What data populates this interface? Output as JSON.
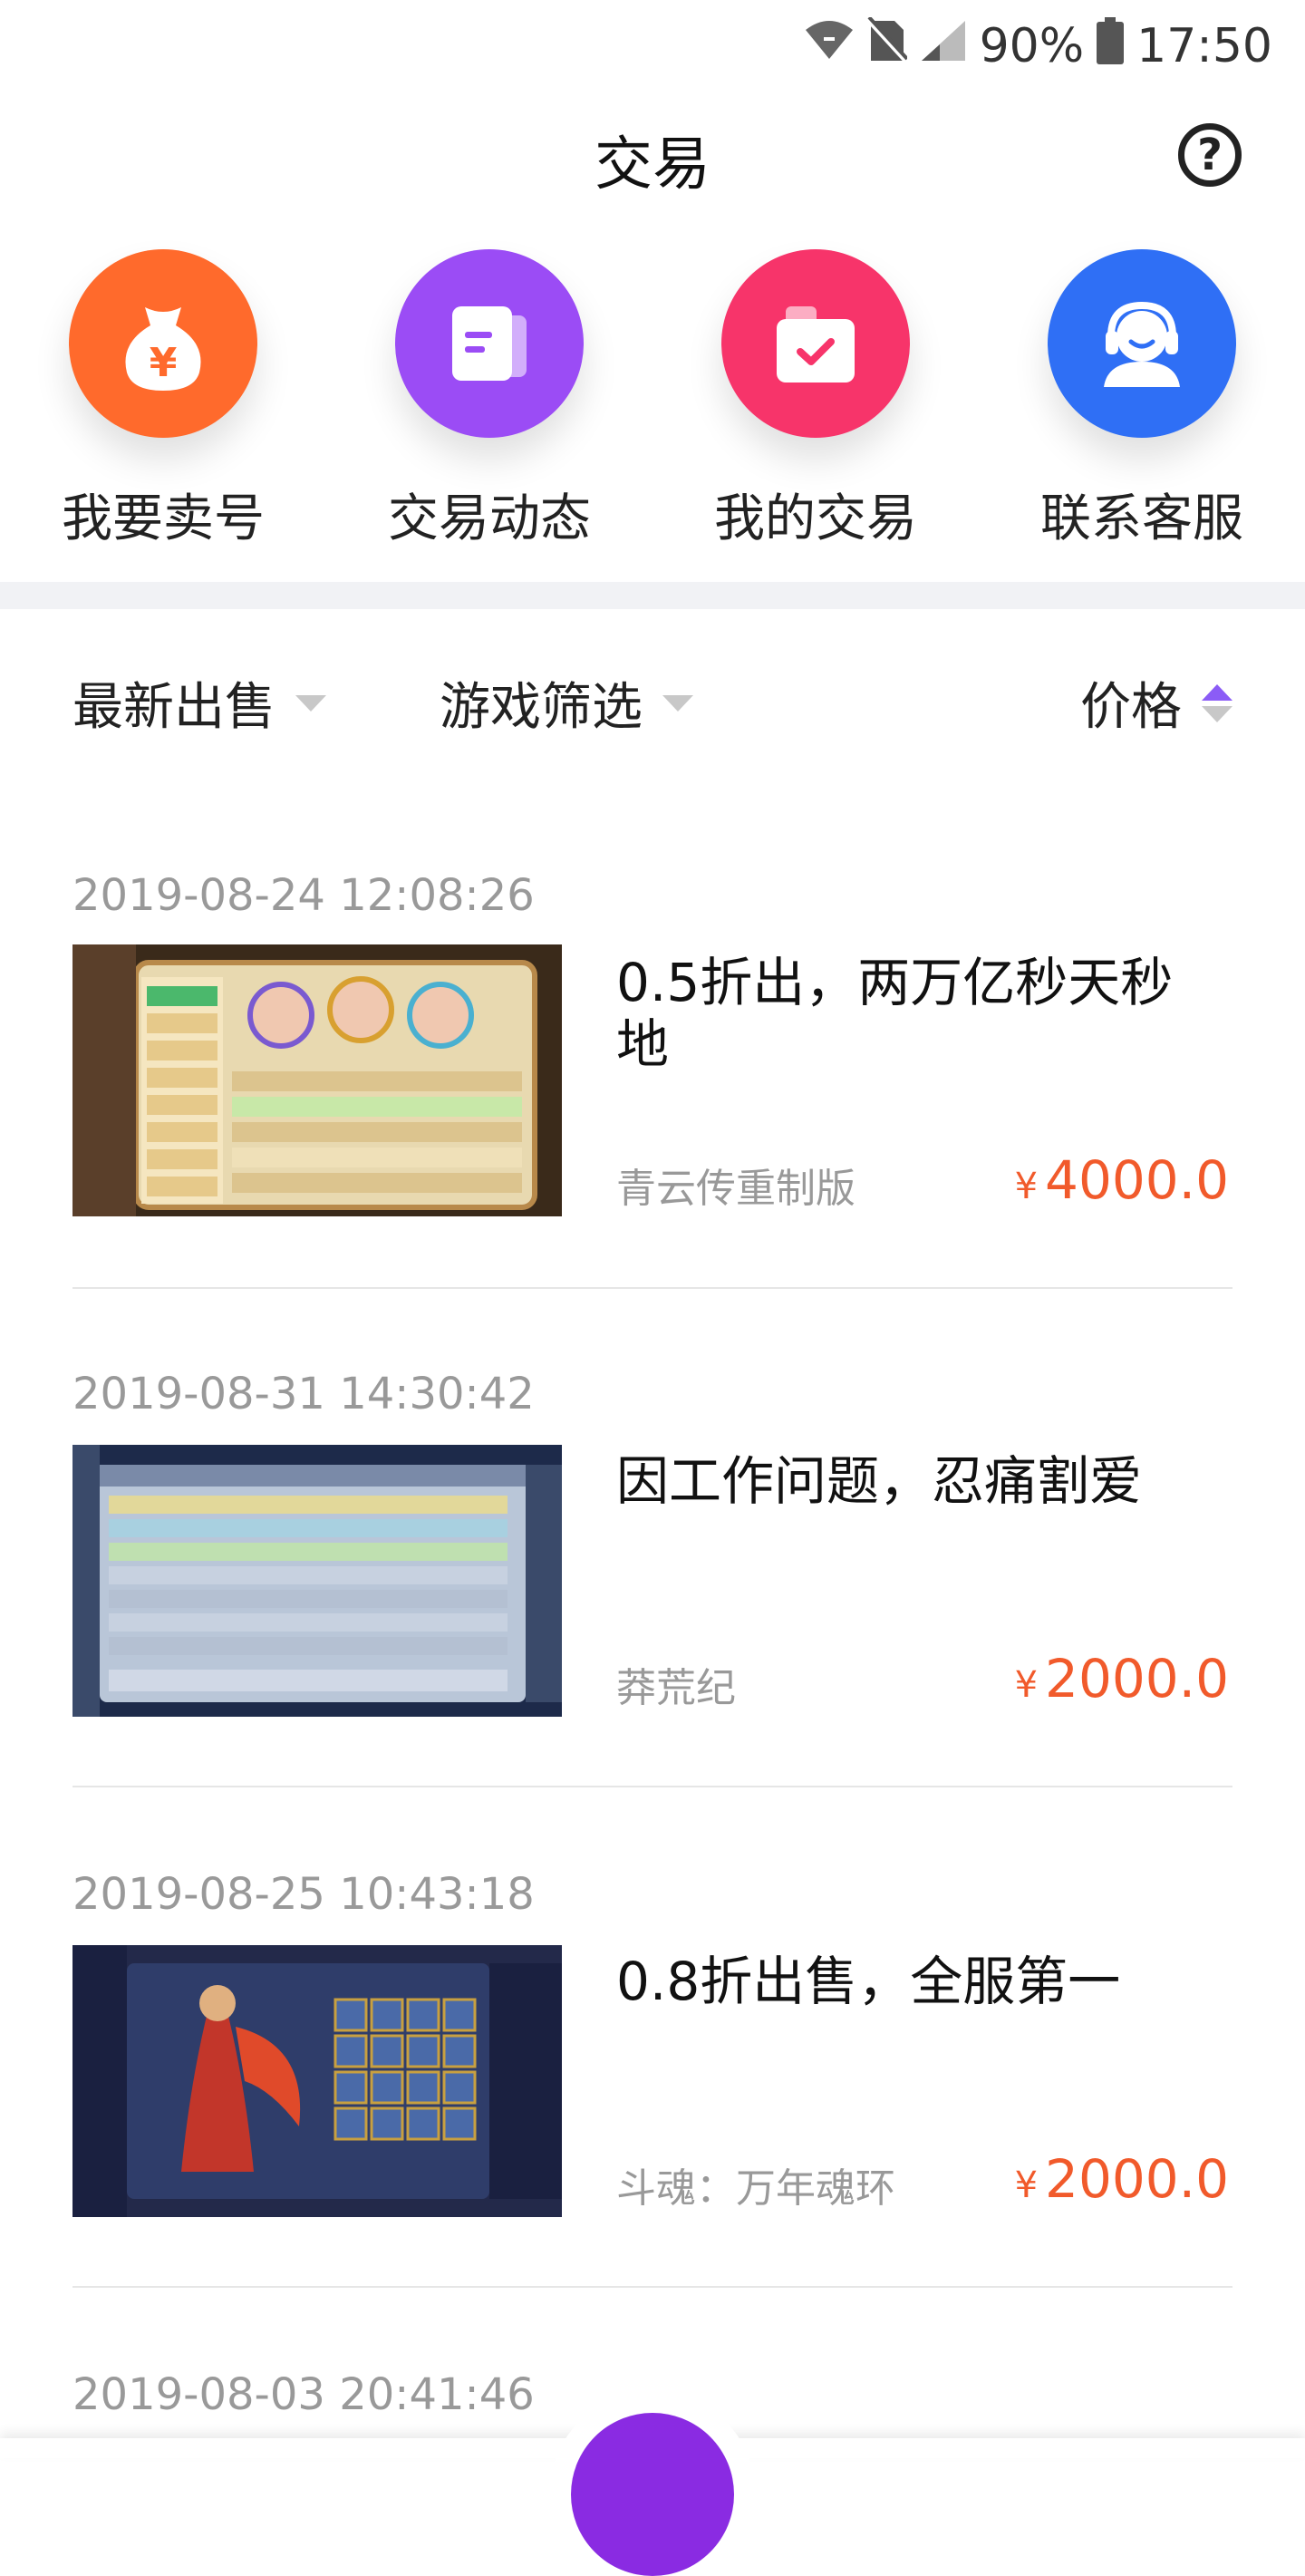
{
  "status_bar": {
    "battery": "90%",
    "time": "17:50"
  },
  "header": {
    "title": "交易"
  },
  "shortcuts": [
    {
      "label": "我要卖号",
      "icon": "money-bag-icon",
      "color": "#ff6a2c"
    },
    {
      "label": "交易动态",
      "icon": "document-icon",
      "color": "#9b4cf5"
    },
    {
      "label": "我的交易",
      "icon": "briefcase-check-icon",
      "color": "#f7346a"
    },
    {
      "label": "联系客服",
      "icon": "customer-service-icon",
      "color": "#2f6ff5"
    }
  ],
  "filters": {
    "latest": "最新出售",
    "game": "游戏筛选",
    "price": "价格"
  },
  "listings": [
    {
      "date": "2019-08-24 12:08:26",
      "title": "0.5折出，两万亿秒天秒地",
      "game": "青云传重制版",
      "currency": "¥",
      "price": "4000.0"
    },
    {
      "date": "2019-08-31 14:30:42",
      "title": "因工作问题，忍痛割爱",
      "game": "莽荒纪",
      "currency": "¥",
      "price": "2000.0"
    },
    {
      "date": "2019-08-25 10:43:18",
      "title": "0.8折出售，全服第一",
      "game": "斗魂：万年魂环",
      "currency": "¥",
      "price": "2000.0"
    },
    {
      "date": "2019-08-03 20:41:46"
    }
  ],
  "colors": {
    "accent": "#8b5cf6",
    "price": "#f15a2b"
  }
}
